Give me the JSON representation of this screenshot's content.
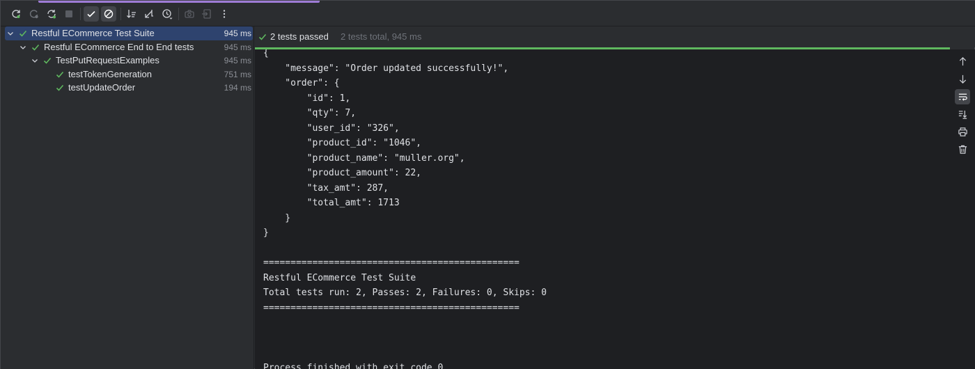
{
  "toolbar": {
    "buttons": [
      {
        "icon": "rerun-icon"
      },
      {
        "icon": "rerun-failed-icon"
      },
      {
        "icon": "toggle-auto-test-icon"
      },
      {
        "icon": "stop-icon"
      },
      {
        "icon": "show-passed-icon",
        "active": true
      },
      {
        "icon": "show-ignored-icon",
        "active": true
      },
      {
        "icon": "sort-alphabetically-icon"
      },
      {
        "icon": "collapse-all-icon"
      },
      {
        "icon": "sort-by-duration-icon"
      },
      {
        "icon": "camera-icon"
      },
      {
        "icon": "import-tests-icon"
      },
      {
        "icon": "more-options-icon"
      }
    ]
  },
  "tree": {
    "items": [
      {
        "label": "Restful ECommerce Test Suite",
        "duration": "945 ms",
        "level": 0,
        "selected": true
      },
      {
        "label": "Restful ECommerce End to End tests",
        "duration": "945 ms",
        "level": 1
      },
      {
        "label": "TestPutRequestExamples",
        "duration": "945 ms",
        "level": 2
      },
      {
        "label": "testTokenGeneration",
        "duration": "751 ms",
        "level": 3
      },
      {
        "label": "testUpdateOrder",
        "duration": "194 ms",
        "level": 3
      }
    ]
  },
  "status": {
    "passed": "2 tests passed",
    "total": "2 tests total, 945 ms"
  },
  "console": {
    "output": "{\n    \"message\": \"Order updated successfully!\",\n    \"order\": {\n        \"id\": 1,\n        \"qty\": 7,\n        \"user_id\": \"326\",\n        \"product_id\": \"1046\",\n        \"product_name\": \"muller.org\",\n        \"product_amount\": 22,\n        \"tax_amt\": 287,\n        \"total_amt\": 1713\n    }\n}\n\n===============================================\nRestful ECommerce Test Suite\nTotal tests run: 2, Passes: 2, Failures: 0, Skips: 0\n===============================================\n\n\n\nProcess finished with exit code 0"
  },
  "side_tools": [
    {
      "icon": "up-arrow-icon"
    },
    {
      "icon": "down-arrow-icon"
    },
    {
      "icon": "soft-wrap-icon",
      "active": true
    },
    {
      "icon": "scroll-to-end-icon"
    },
    {
      "icon": "print-icon"
    },
    {
      "icon": "trash-icon"
    }
  ],
  "colors": {
    "pass_green": "#5fb85f",
    "selection": "#2e436e",
    "accent": "#9e7cd6"
  }
}
